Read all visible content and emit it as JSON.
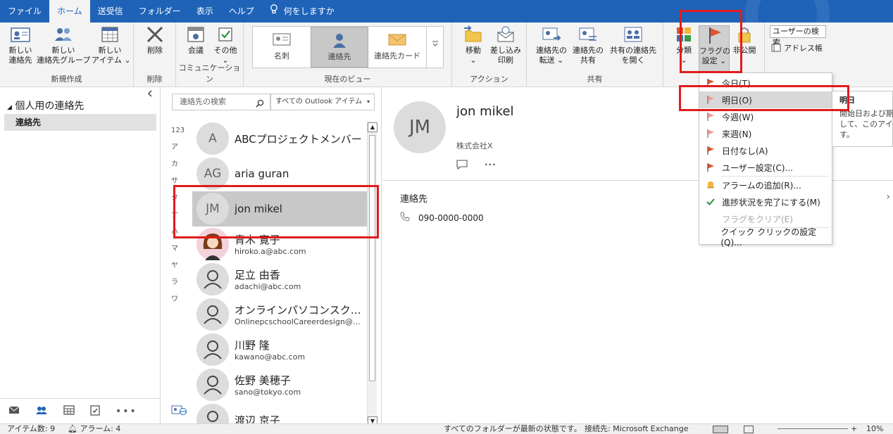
{
  "tabs": [
    "ファイル",
    "ホーム",
    "送受信",
    "フォルダー",
    "表示",
    "ヘルプ"
  ],
  "tell_me": "何をしますか",
  "ribbon": {
    "new_group": {
      "label": "新規作成",
      "new_contact": "新しい\n連絡先",
      "new_group": "新しい\n連絡先グループ",
      "new_items": "新しい\nアイテム ⌄"
    },
    "delete_group": {
      "label": "削除",
      "delete": "削除"
    },
    "comm_group": {
      "label": "コミュニケーション",
      "meeting": "会議",
      "more": "その他\n⌄"
    },
    "view_group": {
      "label": "現在のビュー",
      "views": [
        "名刺",
        "連絡先",
        "連絡先カード"
      ]
    },
    "action_group": {
      "label": "アクション",
      "move": "移動\n⌄",
      "mail_merge": "差し込み\n印刷"
    },
    "share_group": {
      "label": "共有",
      "forward": "連絡先の\n転送 ⌄",
      "share": "連絡先の\n共有",
      "open_shared": "共有の連絡先\nを開く"
    },
    "tags": {
      "categorize": "分類\n⌄",
      "follow_up": "フラグの\n設定 ⌄",
      "private": "非公開"
    },
    "find": {
      "search_people": "ユーザーの検索",
      "address_book": "アドレス帳"
    }
  },
  "left_pane": {
    "header": "個人用の連絡先",
    "folder": "連絡先"
  },
  "contact_search": {
    "placeholder": "連絡先の検索",
    "scope": "すべての Outlook アイテム"
  },
  "index_letters": [
    "123",
    "ア",
    "カ",
    "サ",
    "タ",
    "ナ",
    "ハ",
    "マ",
    "ヤ",
    "ラ",
    "ワ"
  ],
  "contacts": [
    {
      "initials": "A",
      "name": "ABCプロジェクトメンバー",
      "email": ""
    },
    {
      "initials": "AG",
      "name": "aria guran",
      "email": ""
    },
    {
      "initials": "JM",
      "name": "jon mikel",
      "email": "",
      "selected": true
    },
    {
      "initials": "",
      "name": "青木 寛子",
      "email": "hiroko.a@abc.com",
      "photo": true
    },
    {
      "initials": "",
      "name": "足立 由香",
      "email": "adachi@abc.com"
    },
    {
      "initials": "",
      "name": "オンラインパソコンスクール…",
      "email": "OnlinepcschoolCareerdesign@o…"
    },
    {
      "initials": "",
      "name": "川野 隆",
      "email": "kawano@abc.com"
    },
    {
      "initials": "",
      "name": "佐野 美穂子",
      "email": "sano@tokyo.com"
    },
    {
      "initials": "",
      "name": "渡辺 京子",
      "email": ""
    }
  ],
  "detail": {
    "initials": "JM",
    "name": "jon mikel",
    "company": "株式会社X",
    "section": "連絡先",
    "phone": "090-0000-0000"
  },
  "flag_menu": [
    {
      "label": "今日(T)",
      "icon": "flag-red"
    },
    {
      "label": "明日(O)",
      "icon": "flag-light",
      "highlight": true
    },
    {
      "label": "今週(W)",
      "icon": "flag-light"
    },
    {
      "label": "来週(N)",
      "icon": "flag-light"
    },
    {
      "label": "日付なし(A)",
      "icon": "flag-red"
    },
    {
      "label": "ユーザー設定(C)...",
      "icon": "flag-red"
    },
    {
      "label": "アラームの追加(R)...",
      "icon": "bell",
      "sep_before": true
    },
    {
      "label": "進捗状況を完了にする(M)",
      "icon": "check"
    },
    {
      "label": "フラグをクリア(E)",
      "icon": "none",
      "disabled": true
    },
    {
      "label": "クイック クリックの設定(Q)...",
      "icon": "none",
      "sep_before": true
    }
  ],
  "tooltip": {
    "title": "明日",
    "body": "開始日および期\nして、このアイテム\nす。"
  },
  "status": {
    "items": "アイテム数: 9",
    "reminders": "アラーム: 4",
    "sync": "すべてのフォルダーが最新の状態です。",
    "connection": "接続先: Microsoft Exchange",
    "zoom": "10%"
  },
  "colors": {
    "accent": "#1f63b8",
    "highlight": "#e01b1b",
    "flag": "#e0532f"
  }
}
